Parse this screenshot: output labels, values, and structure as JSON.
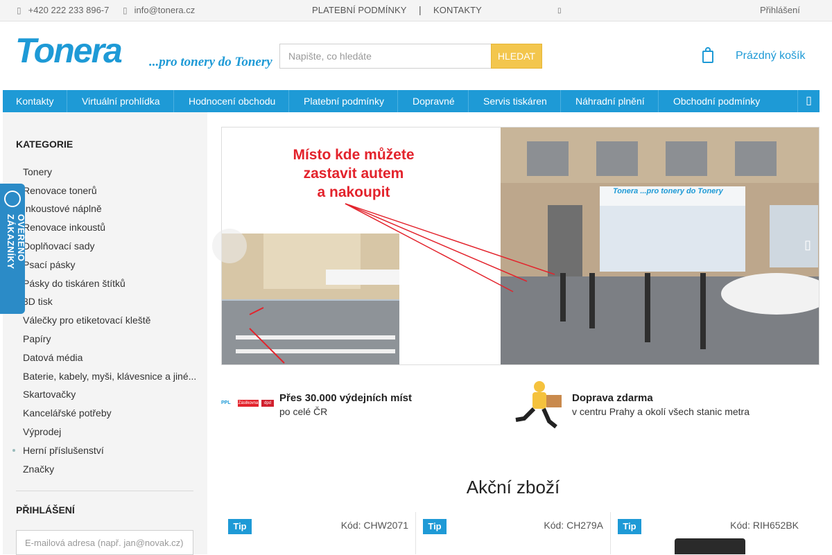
{
  "topbar": {
    "phone": "+420 222 233 896-7",
    "email": "info@tonera.cz",
    "nav": [
      "PLATEBNÍ PODMÍNKY",
      "KONTAKTY"
    ],
    "login": "Přihlášení"
  },
  "logo": {
    "brand": "Tonera",
    "tagline": "...pro tonery do Tonery"
  },
  "search": {
    "placeholder": "Napište, co hledáte",
    "button": "HLEDAT"
  },
  "cart": {
    "label": "Prázdný košík"
  },
  "menu": [
    "Kontakty",
    "Virtuální prohlídka",
    "Hodnocení obchodu",
    "Platební podmínky",
    "Dopravné",
    "Servis tiskáren",
    "Náhradní plnění",
    "Obchodní podmínky"
  ],
  "sidebar": {
    "title": "KATEGORIE",
    "categories": [
      "Tonery",
      "Renovace tonerů",
      "Inkoustové náplně",
      "Renovace inkoustů",
      "Doplňovací sady",
      "Psací pásky",
      "Pásky do tiskáren štítků",
      "3D tisk",
      "Válečky pro etiketovací kleště",
      "Papíry",
      "Datová média",
      "Baterie, kabely, myši, klávesnice a jiné...",
      "Skartovačky",
      "Kancelářské potřeby",
      "Výprodej",
      "Herní příslušenství",
      "Značky"
    ],
    "login_title": "PŘIHLÁŠENÍ",
    "email_placeholder": "E-mailová adresa (např. jan@novak.cz)"
  },
  "badge": {
    "text": "OVĚŘENO ZÁKAZNÍKY"
  },
  "banner": {
    "text_lines": [
      "Místo kde můžete",
      "zastavit autem",
      "a nakoupit"
    ],
    "sign": "Tonera ...pro tonery do Tonery"
  },
  "features": [
    {
      "icon": "carriers-logos-icon",
      "title": "Přes 30.000 výdejních míst",
      "subtitle": "po celé ČR"
    },
    {
      "icon": "courier-icon",
      "title": "Doprava zdarma",
      "subtitle": "v centru Prahy a okolí všech stanic metra"
    }
  ],
  "carriers": [
    "PPL",
    "Zásilkovna",
    "dpd"
  ],
  "products_section": {
    "title": "Akční zboží",
    "products": [
      {
        "tip": "Tip",
        "code": "Kód: CHW2071"
      },
      {
        "tip": "Tip",
        "code": "Kód: CH279A"
      },
      {
        "tip": "Tip",
        "code": "Kód: RIH652BK"
      }
    ]
  },
  "colors": {
    "accent": "#1e9ad6",
    "search_button": "#f3c64d",
    "banner_text": "#e3232c"
  }
}
